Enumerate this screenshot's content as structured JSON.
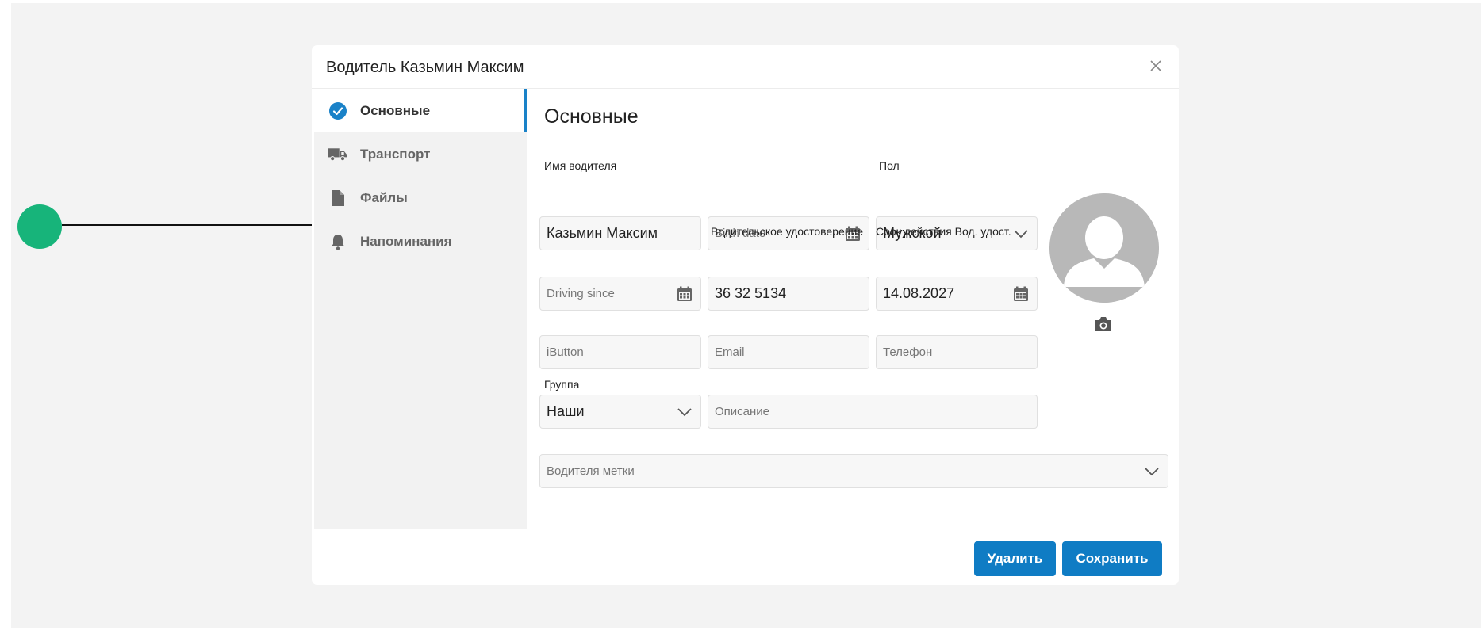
{
  "dialog": {
    "title": "Водитель Казьмин Максим"
  },
  "sidebar": {
    "items": [
      {
        "label": "Основные",
        "icon": "check-circle-icon",
        "active": true
      },
      {
        "label": "Транспорт",
        "icon": "truck-icon",
        "active": false
      },
      {
        "label": "Файлы",
        "icon": "file-icon",
        "active": false
      },
      {
        "label": "Напоминания",
        "icon": "bell-icon",
        "active": false
      }
    ]
  },
  "main": {
    "section_title": "Основные",
    "driver_name": {
      "label": "Имя водителя",
      "value": "Казьмин Максим"
    },
    "birth_date": {
      "placeholder": "Birth date"
    },
    "gender": {
      "label": "Пол",
      "value": "Мужской"
    },
    "driving_since": {
      "placeholder": "Driving since"
    },
    "license": {
      "label": "Водительское удостоверение",
      "value": "36 32 5134"
    },
    "license_expiry": {
      "label": "Срок действия Вод. удост.",
      "value": "14.08.2027"
    },
    "ibutton": {
      "placeholder": "iButton"
    },
    "email": {
      "placeholder": "Email"
    },
    "phone": {
      "placeholder": "Телефон"
    },
    "group": {
      "label": "Группа",
      "value": "Наши"
    },
    "description": {
      "placeholder": "Описание"
    },
    "tags": {
      "placeholder": "Водителя метки"
    }
  },
  "footer": {
    "delete_label": "Удалить",
    "save_label": "Сохранить"
  },
  "colors": {
    "accent": "#0f7cc4",
    "marker": "#17b47a",
    "backdrop": "#f3f3f3"
  }
}
